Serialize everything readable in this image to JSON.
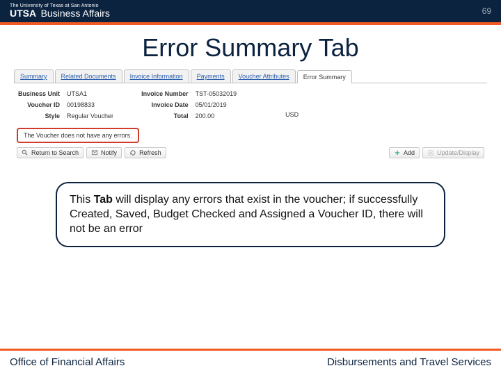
{
  "header": {
    "brand_pre": "The University of Texas at San Antonio",
    "brand_main": "UTSA",
    "brand_sub": "Business Affairs",
    "page_number": "69"
  },
  "title": "Error Summary Tab",
  "tabs": [
    "Summary",
    "Related Documents",
    "Invoice Information",
    "Payments",
    "Voucher Attributes",
    "Error Summary"
  ],
  "active_tab_index": 5,
  "fields": {
    "left": [
      {
        "label": "Business Unit",
        "value": "UTSA1"
      },
      {
        "label": "Voucher ID",
        "value": "00198833"
      },
      {
        "label": "Style",
        "value": "Regular Voucher"
      }
    ],
    "right": [
      {
        "label": "Invoice Number",
        "value": "TST-05032019"
      },
      {
        "label": "Invoice Date",
        "value": "05/01/2019"
      },
      {
        "label": "Total",
        "value": "200.00"
      }
    ],
    "currency": "USD"
  },
  "message": "The Voucher does not have any errors.",
  "buttons": {
    "return": "Return to Search",
    "notify": "Notify",
    "refresh": "Refresh",
    "add": "Add",
    "update": "Update/Display"
  },
  "callout": {
    "prefix": "This ",
    "bold": "Tab",
    "rest": " will display any errors that exist in the voucher; if successfully Created, Saved, Budget Checked and Assigned a Voucher ID, there will not be an error"
  },
  "footer": {
    "left": "Office of Financial Affairs",
    "right": "Disbursements and Travel Services"
  }
}
